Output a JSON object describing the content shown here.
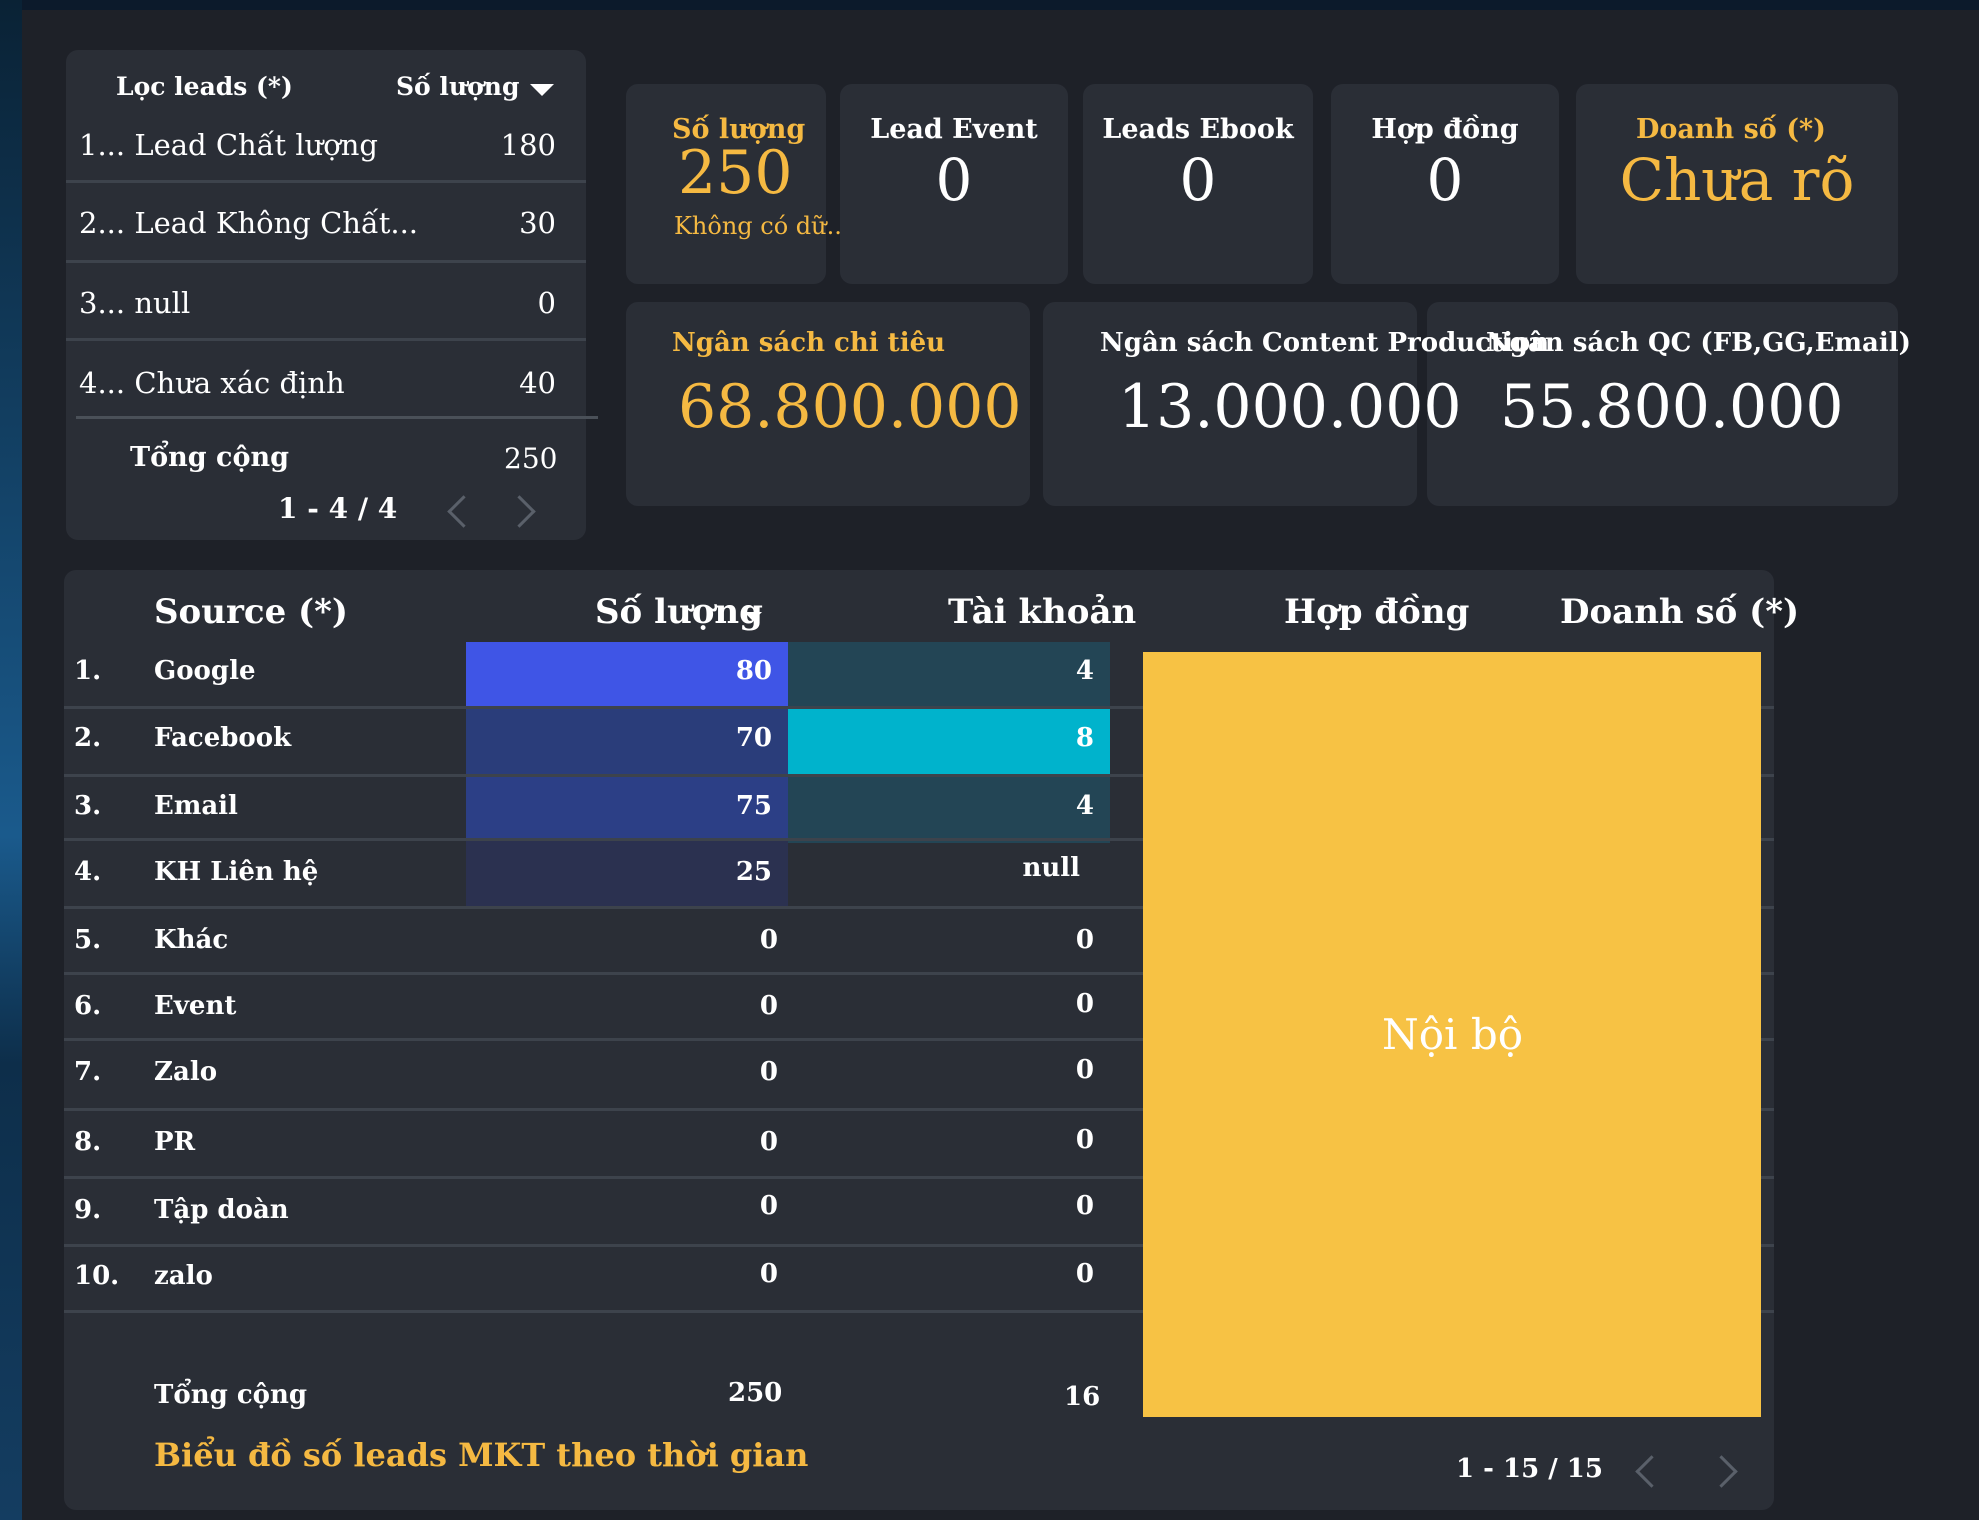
{
  "filter": {
    "header_label": "Lọc leads (*)",
    "header_metric": "Số lượng",
    "rows": [
      {
        "label": "1... Lead Chất lượng",
        "value": "180"
      },
      {
        "label": "2... Lead Không Chất...",
        "value": "30"
      },
      {
        "label": "3... null",
        "value": "0"
      },
      {
        "label": "4... Chưa xác định",
        "value": "40"
      }
    ],
    "total_label": "Tổng cộng",
    "total_value": "250",
    "pagination": "1 - 4 / 4"
  },
  "kpis": {
    "so_luong": {
      "title": "Số lượng",
      "value": "250",
      "sub": "Không có dữ.."
    },
    "lead_event": {
      "title": "Lead Event",
      "value": "0"
    },
    "leads_ebook": {
      "title": "Leads Ebook",
      "value": "0"
    },
    "hop_dong": {
      "title": "Hợp đồng",
      "value": "0"
    },
    "doanh_so": {
      "title": "Doanh số (*)",
      "value": "Chưa rõ"
    },
    "ngan_sach_chi_tieu": {
      "title": "Ngân sách chi tiêu",
      "value": "68.800.000"
    },
    "ngan_sach_content": {
      "title": "Ngân sách Content Production",
      "value": "13.000.000"
    },
    "ngan_sach_qc": {
      "title": "Ngân sách QC (FB,GG,Email)",
      "value": "55.800.000"
    }
  },
  "source_table": {
    "headers": {
      "source": "Source (*)",
      "so_luong": "Số lượng",
      "tai_khoan": "Tài khoản",
      "hop_dong": "Hợp đồng",
      "doanh_so": "Doanh số (*)"
    },
    "rows": [
      {
        "idx": "1.",
        "name": "Google",
        "qty": "80",
        "acc": "4"
      },
      {
        "idx": "2.",
        "name": "Facebook",
        "qty": "70",
        "acc": "8"
      },
      {
        "idx": "3.",
        "name": "Email",
        "qty": "75",
        "acc": "4"
      },
      {
        "idx": "4.",
        "name": "KH Liên hệ",
        "qty": "25",
        "acc": "null"
      },
      {
        "idx": "5.",
        "name": "Khác",
        "qty": "0",
        "acc": "0"
      },
      {
        "idx": "6.",
        "name": "Event",
        "qty": "0",
        "acc": "0"
      },
      {
        "idx": "7.",
        "name": "Zalo",
        "qty": "0",
        "acc": "0"
      },
      {
        "idx": "8.",
        "name": "PR",
        "qty": "0",
        "acc": "0"
      },
      {
        "idx": "9.",
        "name": "Tập doàn",
        "qty": "0",
        "acc": "0"
      },
      {
        "idx": "10.",
        "name": "zalo",
        "qty": "0",
        "acc": "0"
      }
    ],
    "total_label": "Tổng cộng",
    "total_qty": "250",
    "total_acc": "16",
    "overlay_text": "Nội bộ",
    "chart_caption": "Biểu đồ số leads MKT theo thời gian",
    "pagination": "1 - 15 / 15"
  },
  "colors": {
    "accent_orange": "#f5b942",
    "overlay_yellow": "#f7c244",
    "qty_highlight": "#3f55e6",
    "acc_highlight": "#00b3cc"
  }
}
